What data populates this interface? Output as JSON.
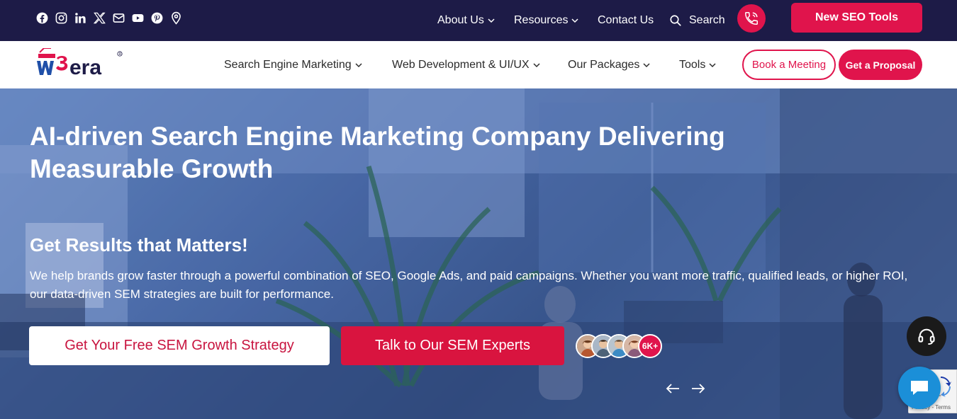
{
  "colors": {
    "topbar": "#1d1b47",
    "accent": "#e0144c",
    "white": "#ffffff"
  },
  "topbar": {
    "social_icons": [
      "facebook-icon",
      "instagram-icon",
      "linkedin-icon",
      "x-icon",
      "mail-icon",
      "youtube-icon",
      "pinterest-icon",
      "location-icon"
    ],
    "nav": [
      {
        "label": "About Us",
        "has_dropdown": true
      },
      {
        "label": "Resources",
        "has_dropdown": true
      },
      {
        "label": "Contact Us",
        "has_dropdown": false
      }
    ],
    "search_label": "Search",
    "phone_icon": "phone-call-icon",
    "cta_label": "New SEO Tools"
  },
  "header": {
    "logo_text": "w3era",
    "nav": [
      {
        "label": "Search Engine Marketing",
        "has_dropdown": true
      },
      {
        "label": "Web Development & UI/UX",
        "has_dropdown": true
      },
      {
        "label": "Our Packages",
        "has_dropdown": true
      },
      {
        "label": "Tools",
        "has_dropdown": true
      }
    ],
    "book_label": "Book a Meeting",
    "proposal_label": "Get a Proposal"
  },
  "hero": {
    "title": "AI-driven Search Engine Marketing Company Delivering Measurable Growth",
    "subtitle": "Get Results that Matters!",
    "description": "We help brands grow faster through a powerful combination of SEO, Google Ads, and paid campaigns. Whether you want more traffic, qualified leads, or higher ROI, our data-driven SEM strategies are built for performance.",
    "cta_primary": "Get Your Free SEM Growth Strategy",
    "cta_secondary": "Talk to Our SEM Experts",
    "avatar_count_label": "6K+"
  },
  "widgets": {
    "recaptcha_terms": "Privacy - Terms"
  }
}
